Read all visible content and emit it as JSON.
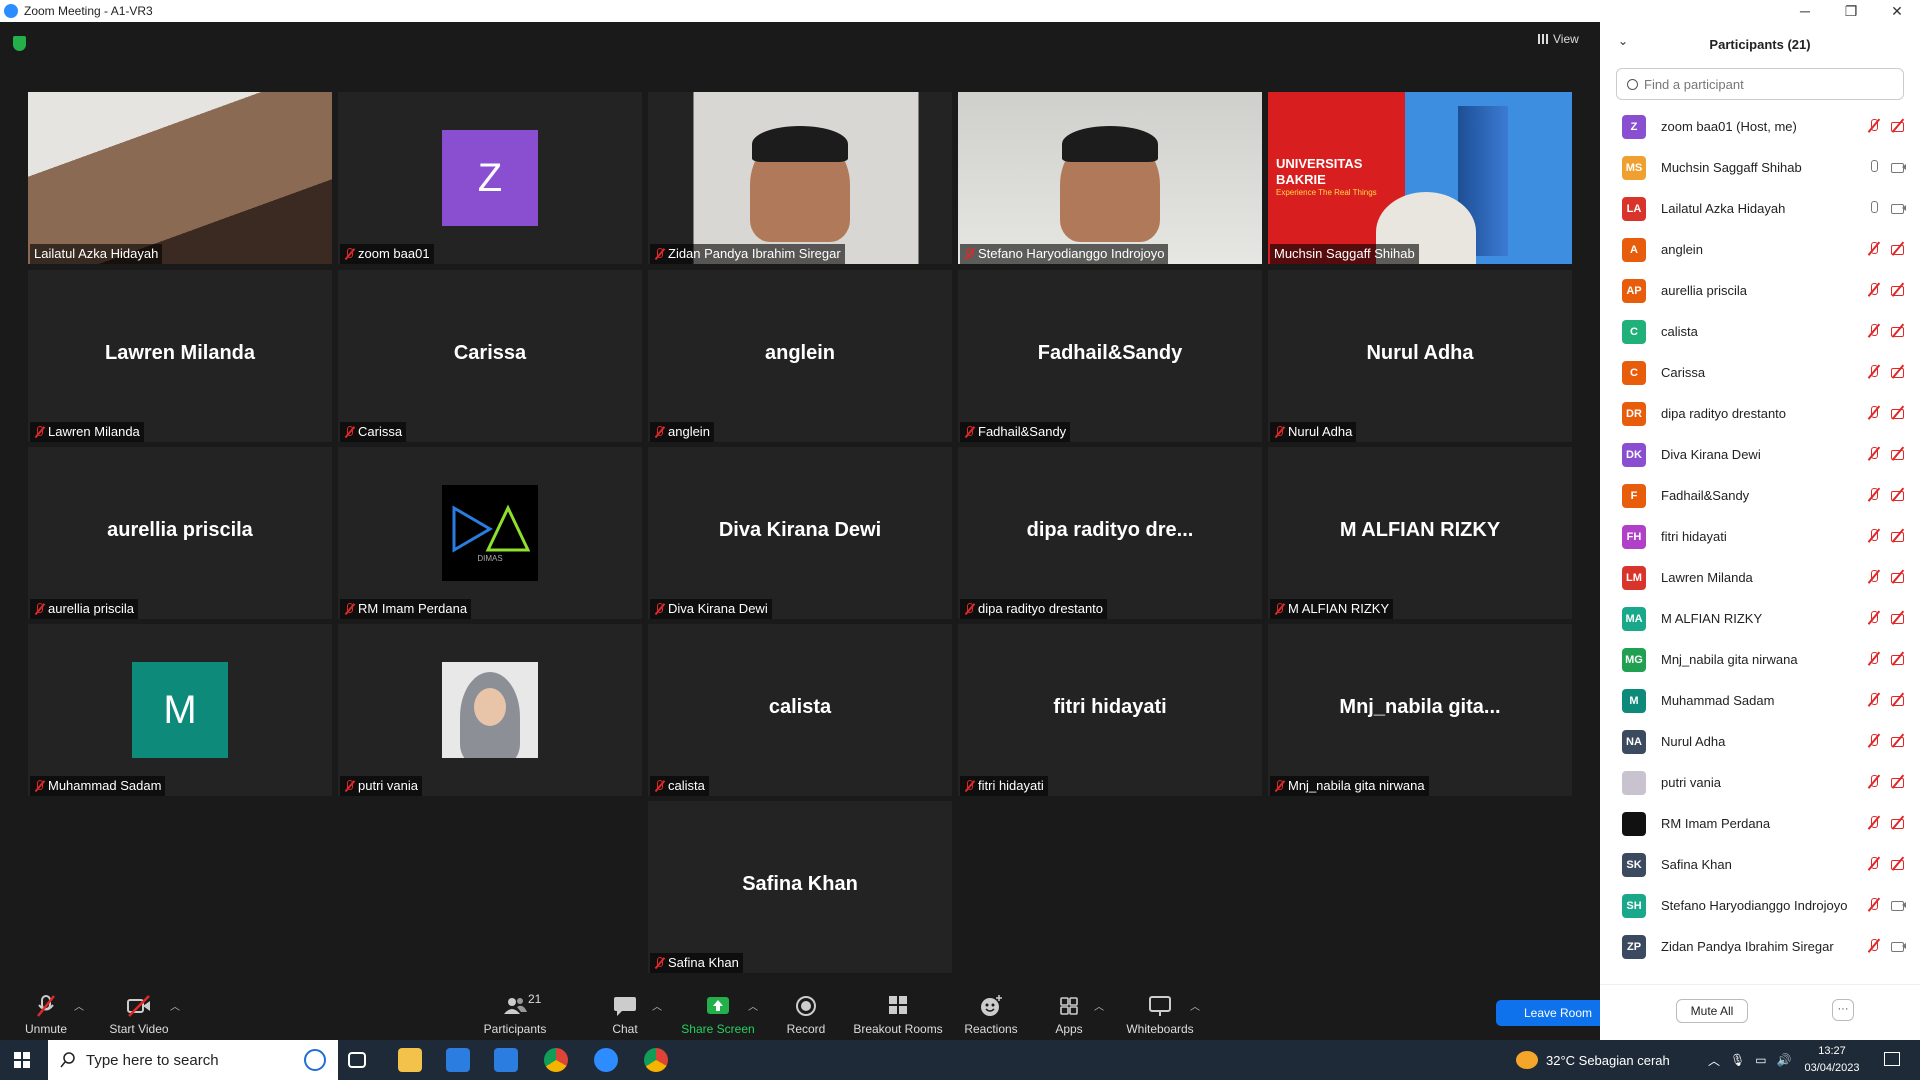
{
  "window": {
    "title": "Zoom Meeting - A1-VR3",
    "minimize": "─",
    "restore": "❐",
    "close": "✕"
  },
  "meeting": {
    "view_label": "View"
  },
  "tiles": [
    {
      "name": "Lailatul Azka Hidayah",
      "type": "video",
      "mic_muted": false
    },
    {
      "name": "zoom baa01",
      "type": "avatar",
      "initial": "Z",
      "color": "#8a4fd1",
      "mic_muted": true
    },
    {
      "name": "Zidan Pandya Ibrahim Siregar",
      "type": "video",
      "mic_muted": true
    },
    {
      "name": "Stefano Haryodianggo Indrojoyo",
      "type": "video",
      "mic_muted": true
    },
    {
      "name": "Muchsin Saggaff Shihab",
      "type": "video",
      "mic_muted": false,
      "active": true,
      "banner_line1": "UNIVERSITAS",
      "banner_line2": "BAKRIE",
      "banner_line3": "Experience The Real Things"
    },
    {
      "name": "Lawren Milanda",
      "type": "name",
      "display": "Lawren Milanda",
      "mic_muted": true
    },
    {
      "name": "Carissa",
      "type": "name",
      "display": "Carissa",
      "mic_muted": true
    },
    {
      "name": "anglein",
      "type": "name",
      "display": "anglein",
      "mic_muted": true
    },
    {
      "name": "Fadhail&Sandy",
      "type": "name",
      "display": "Fadhail&Sandy",
      "mic_muted": true
    },
    {
      "name": "Nurul Adha",
      "type": "name",
      "display": "Nurul Adha",
      "mic_muted": true
    },
    {
      "name": "aurellia priscila",
      "type": "name",
      "display": "aurellia priscila",
      "mic_muted": true
    },
    {
      "name": "RM Imam Perdana",
      "type": "logo",
      "logo_text": "DIMAS",
      "mic_muted": true
    },
    {
      "name": "Diva Kirana Dewi",
      "type": "name",
      "display": "Diva Kirana Dewi",
      "mic_muted": true
    },
    {
      "name": "dipa radityo drestanto",
      "type": "name",
      "display": "dipa radityo dre...",
      "mic_muted": true
    },
    {
      "name": "M ALFIAN RIZKY",
      "type": "name",
      "display": "M ALFIAN RIZKY",
      "mic_muted": true
    },
    {
      "name": "Muhammad Sadam",
      "type": "avatar",
      "initial": "M",
      "color": "#0e8a7a",
      "mic_muted": true
    },
    {
      "name": "putri vania",
      "type": "photo",
      "mic_muted": true
    },
    {
      "name": "calista",
      "type": "name",
      "display": "calista",
      "mic_muted": true
    },
    {
      "name": "fitri hidayati",
      "type": "name",
      "display": "fitri hidayati",
      "mic_muted": true
    },
    {
      "name": "Mnj_nabila gita nirwana",
      "type": "name",
      "display": "Mnj_nabila  gita...",
      "mic_muted": true
    },
    {
      "name": "Safina Khan",
      "type": "name",
      "display": "Safina Khan",
      "mic_muted": true
    }
  ],
  "toolbar": {
    "unmute": "Unmute",
    "start_video": "Start Video",
    "participants": "Participants",
    "participants_count": "21",
    "chat": "Chat",
    "share_screen": "Share Screen",
    "record": "Record",
    "breakout_rooms": "Breakout Rooms",
    "reactions": "Reactions",
    "apps": "Apps",
    "whiteboards": "Whiteboards",
    "leave": "Leave Room"
  },
  "panel": {
    "title": "Participants (21)",
    "search_placeholder": "Find a participant",
    "mute_all": "Mute All",
    "more": "···",
    "participants": [
      {
        "initials": "Z",
        "name": "zoom baa01 (Host, me)",
        "color": "#8a4fd1",
        "mic": "off",
        "cam": "off"
      },
      {
        "initials": "MS",
        "name": "Muchsin Saggaff Shihab",
        "color": "#f0a030",
        "mic": "on",
        "cam": "on"
      },
      {
        "initials": "LA",
        "name": "Lailatul Azka Hidayah",
        "color": "#d9342b",
        "mic": "on",
        "cam": "on"
      },
      {
        "initials": "A",
        "name": "anglein",
        "color": "#e85d0c",
        "mic": "off",
        "cam": "off"
      },
      {
        "initials": "AP",
        "name": "aurellia priscila",
        "color": "#e85d0c",
        "mic": "off",
        "cam": "off"
      },
      {
        "initials": "C",
        "name": "calista",
        "color": "#20b07a",
        "mic": "off",
        "cam": "off"
      },
      {
        "initials": "C",
        "name": "Carissa",
        "color": "#e85d0c",
        "mic": "off",
        "cam": "off"
      },
      {
        "initials": "DR",
        "name": "dipa radityo drestanto",
        "color": "#e85d0c",
        "mic": "off",
        "cam": "off"
      },
      {
        "initials": "DK",
        "name": "Diva Kirana Dewi",
        "color": "#8a4fd1",
        "mic": "off",
        "cam": "off"
      },
      {
        "initials": "F",
        "name": "Fadhail&Sandy",
        "color": "#e85d0c",
        "mic": "off",
        "cam": "off"
      },
      {
        "initials": "FH",
        "name": "fitri hidayati",
        "color": "#b040c8",
        "mic": "off",
        "cam": "off"
      },
      {
        "initials": "LM",
        "name": "Lawren Milanda",
        "color": "#d9342b",
        "mic": "off",
        "cam": "off"
      },
      {
        "initials": "MA",
        "name": "M ALFIAN RIZKY",
        "color": "#1aa88a",
        "mic": "off",
        "cam": "off"
      },
      {
        "initials": "MG",
        "name": "Mnj_nabila gita nirwana",
        "color": "#20a050",
        "mic": "off",
        "cam": "off"
      },
      {
        "initials": "M",
        "name": "Muhammad Sadam",
        "color": "#0e8a7a",
        "mic": "off",
        "cam": "off"
      },
      {
        "initials": "NA",
        "name": "Nurul Adha",
        "color": "#3b4a5e",
        "mic": "off",
        "cam": "off"
      },
      {
        "initials": "",
        "name": "putri vania",
        "color": "#c9c3cf",
        "mic": "off",
        "cam": "off"
      },
      {
        "initials": "",
        "name": "RM Imam Perdana",
        "color": "#111111",
        "mic": "off",
        "cam": "off"
      },
      {
        "initials": "SK",
        "name": "Safina Khan",
        "color": "#3b4a5e",
        "mic": "off",
        "cam": "off"
      },
      {
        "initials": "SH",
        "name": "Stefano Haryodianggo Indrojoyo",
        "color": "#1aa88a",
        "mic": "off",
        "cam": "on"
      },
      {
        "initials": "ZP",
        "name": "Zidan Pandya Ibrahim Siregar",
        "color": "#3b4a5e",
        "mic": "off",
        "cam": "on"
      }
    ]
  },
  "taskbar": {
    "search_placeholder": "Type here to search",
    "weather": "32°C  Sebagian cerah",
    "time": "13:27",
    "date": "03/04/2023"
  },
  "colors": {
    "accent": "#0e72ed",
    "active_speaker": "#d7e54a",
    "muted": "#e02828",
    "share": "#23b04a"
  }
}
